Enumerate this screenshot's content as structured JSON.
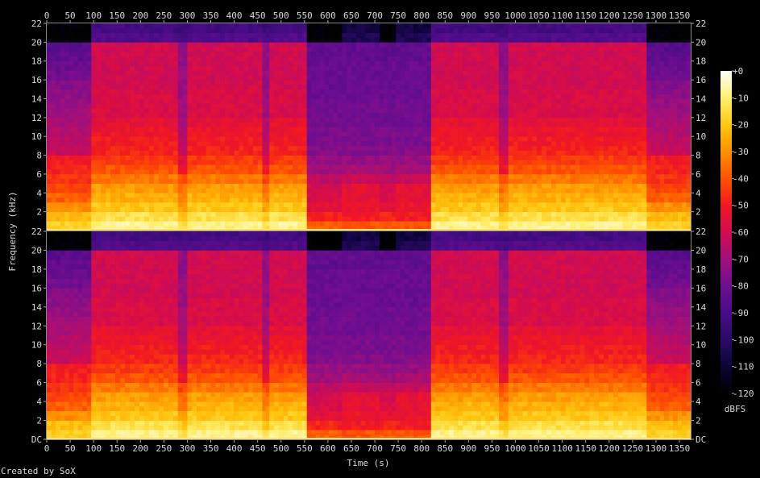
{
  "chart_data": {
    "type": "heatmap",
    "title": "",
    "xlabel": "Time (s)",
    "ylabel": "Frequency (kHz)",
    "xlim": [
      0,
      1375
    ],
    "ylim_khz": [
      0,
      22
    ],
    "x_ticks": [
      0,
      50,
      100,
      150,
      200,
      250,
      300,
      350,
      400,
      450,
      500,
      550,
      600,
      650,
      700,
      750,
      800,
      850,
      900,
      950,
      1000,
      1050,
      1100,
      1150,
      1200,
      1250,
      1300,
      1350
    ],
    "channels": [
      {
        "name": "channel-1",
        "y_tick_labels": [
          "22",
          "20",
          "18",
          "16",
          "14",
          "12",
          "10",
          "8",
          "6",
          "4",
          "2"
        ]
      },
      {
        "name": "channel-2",
        "y_tick_labels": [
          "22",
          "20",
          "18",
          "16",
          "14",
          "12",
          "10",
          "8",
          "6",
          "4",
          "2",
          "DC"
        ]
      }
    ],
    "band_khz": [
      0,
      1,
      2,
      3,
      4,
      5,
      6,
      7,
      8,
      9,
      10,
      11,
      12,
      13,
      14,
      15,
      16,
      17,
      18,
      19,
      20,
      21
    ],
    "profiles": {
      "edge": [
        -18,
        -22,
        -30,
        -38,
        -42,
        -45,
        -48,
        -50,
        -62,
        -64,
        -66,
        -68,
        -70,
        -72,
        -74,
        -76,
        -80,
        -82,
        -84,
        -86,
        -120,
        -120
      ],
      "music": [
        -8,
        -14,
        -20,
        -24,
        -28,
        -34,
        -40,
        -44,
        -48,
        -50,
        -52,
        -54,
        -58,
        -58,
        -58,
        -60,
        -60,
        -60,
        -60,
        -60,
        -88,
        -92
      ],
      "dip": [
        -14,
        -20,
        -28,
        -32,
        -36,
        -42,
        -52,
        -56,
        -62,
        -64,
        -66,
        -68,
        -70,
        -70,
        -72,
        -72,
        -72,
        -74,
        -74,
        -74,
        -90,
        -94
      ],
      "quiet": [
        -38,
        -48,
        -55,
        -58,
        -60,
        -64,
        -70,
        -72,
        -76,
        -78,
        -78,
        -80,
        -80,
        -80,
        -82,
        -82,
        -82,
        -82,
        -84,
        -84,
        -120,
        -120
      ],
      "quiet2": [
        -40,
        -50,
        -52,
        -54,
        -54,
        -62,
        -68,
        -72,
        -76,
        -78,
        -78,
        -80,
        -80,
        -80,
        -82,
        -82,
        -82,
        -82,
        -84,
        -84,
        -104,
        -108
      ]
    },
    "segments": [
      {
        "start": 0,
        "end": 10,
        "profile": "edge"
      },
      {
        "start": 10,
        "end": 95,
        "profile": "edge"
      },
      {
        "start": 95,
        "end": 280,
        "profile": "music"
      },
      {
        "start": 280,
        "end": 300,
        "profile": "dip"
      },
      {
        "start": 300,
        "end": 460,
        "profile": "music"
      },
      {
        "start": 460,
        "end": 475,
        "profile": "dip"
      },
      {
        "start": 475,
        "end": 555,
        "profile": "music"
      },
      {
        "start": 555,
        "end": 630,
        "profile": "quiet"
      },
      {
        "start": 630,
        "end": 710,
        "profile": "quiet2"
      },
      {
        "start": 710,
        "end": 745,
        "profile": "quiet"
      },
      {
        "start": 745,
        "end": 820,
        "profile": "quiet2"
      },
      {
        "start": 820,
        "end": 965,
        "profile": "music"
      },
      {
        "start": 965,
        "end": 985,
        "profile": "dip"
      },
      {
        "start": 985,
        "end": 1280,
        "profile": "music"
      },
      {
        "start": 1280,
        "end": 1375,
        "profile": "edge"
      }
    ],
    "colorbar": {
      "label": "dBFS",
      "range": [
        -120,
        0
      ],
      "tick_labels": [
        "+0",
        "-10",
        "-20",
        "-30",
        "-40",
        "-50",
        "-60",
        "-70",
        "-80",
        "-90",
        "-100",
        "-110",
        "-120"
      ],
      "tick_values": [
        0,
        -10,
        -20,
        -30,
        -40,
        -50,
        -60,
        -70,
        -80,
        -90,
        -100,
        -110,
        -120
      ],
      "stops": [
        {
          "db": -120,
          "color": "#000000"
        },
        {
          "db": -110,
          "color": "#0c0438"
        },
        {
          "db": -100,
          "color": "#2a0a66"
        },
        {
          "db": -90,
          "color": "#4a0c88"
        },
        {
          "db": -80,
          "color": "#700e90"
        },
        {
          "db": -70,
          "color": "#a0107c"
        },
        {
          "db": -60,
          "color": "#d20c50"
        },
        {
          "db": -50,
          "color": "#f21822"
        },
        {
          "db": -40,
          "color": "#ff5200"
        },
        {
          "db": -30,
          "color": "#ff9200"
        },
        {
          "db": -20,
          "color": "#ffc810"
        },
        {
          "db": -10,
          "color": "#fff070"
        },
        {
          "db": 0,
          "color": "#ffffff"
        }
      ]
    }
  },
  "footer": {
    "credit": "Created by SoX"
  }
}
